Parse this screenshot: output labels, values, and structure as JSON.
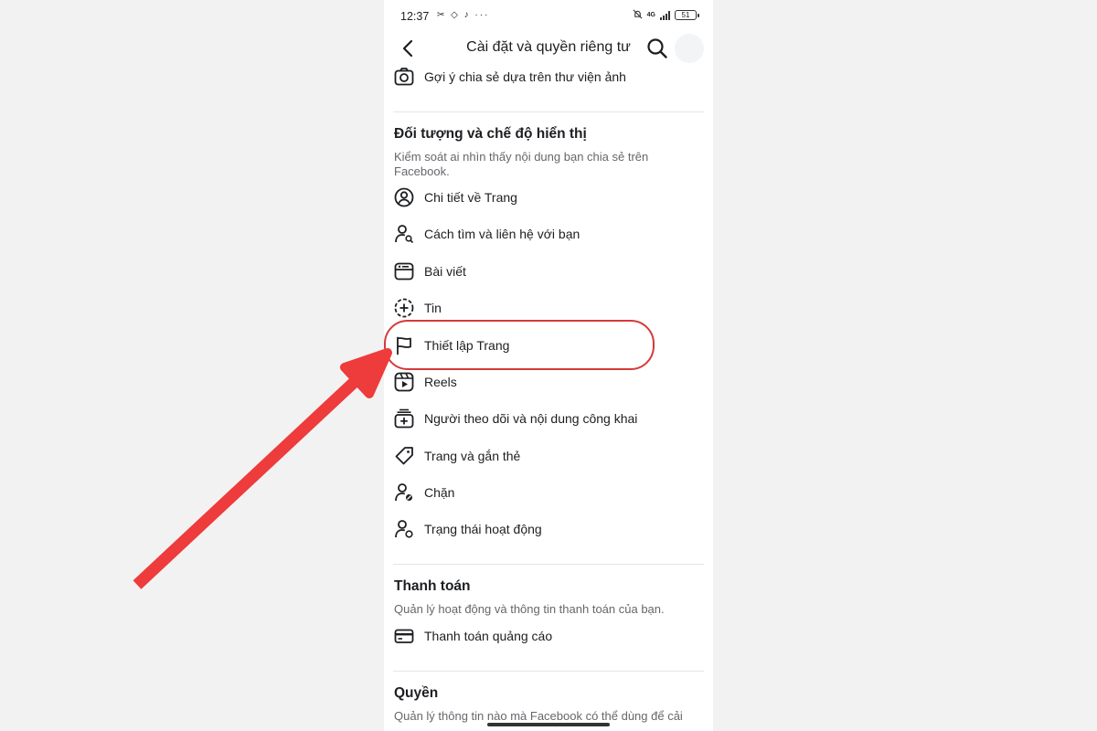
{
  "status": {
    "time": "12:37",
    "left_icons": "✂ ◇ ♪ ···",
    "net": "4G",
    "battery": "51"
  },
  "header": {
    "title": "Cài đặt và quyền riêng tư"
  },
  "top_item": {
    "label": "Gợi ý chia sẻ dựa trên thư viện ảnh",
    "icon": "camera-icon"
  },
  "audience": {
    "title": "Đối tượng và chế độ hiển thị",
    "desc": "Kiểm soát ai nhìn thấy nội dung bạn chia sẻ trên Facebook.",
    "items": [
      {
        "label": "Chi tiết về Trang",
        "icon": "profile-circle-icon"
      },
      {
        "label": "Cách tìm và liên hệ với bạn",
        "icon": "person-search-icon"
      },
      {
        "label": "Bài viết",
        "icon": "posts-icon"
      },
      {
        "label": "Tin",
        "icon": "story-add-icon"
      },
      {
        "label": "Thiết lập Trang",
        "icon": "flag-icon"
      },
      {
        "label": "Reels",
        "icon": "reels-icon"
      },
      {
        "label": "Người theo dõi và nội dung công khai",
        "icon": "followers-icon"
      },
      {
        "label": "Trang và gắn thẻ",
        "icon": "tag-icon"
      },
      {
        "label": "Chặn",
        "icon": "person-block-icon"
      },
      {
        "label": "Trạng thái hoạt động",
        "icon": "person-status-icon"
      }
    ]
  },
  "payments": {
    "title": "Thanh toán",
    "desc": "Quản lý hoạt động và thông tin thanh toán của bạn.",
    "items": [
      {
        "label": "Thanh toán quảng cáo",
        "icon": "card-icon"
      }
    ]
  },
  "permissions": {
    "title": "Quyền",
    "desc": "Quản lý thông tin nào mà Facebook có thể dùng để cải"
  },
  "colors": {
    "highlight": "#d63a3a",
    "arrow": "#ee3b3b",
    "text": "#1c1e21",
    "muted": "#65676b"
  }
}
